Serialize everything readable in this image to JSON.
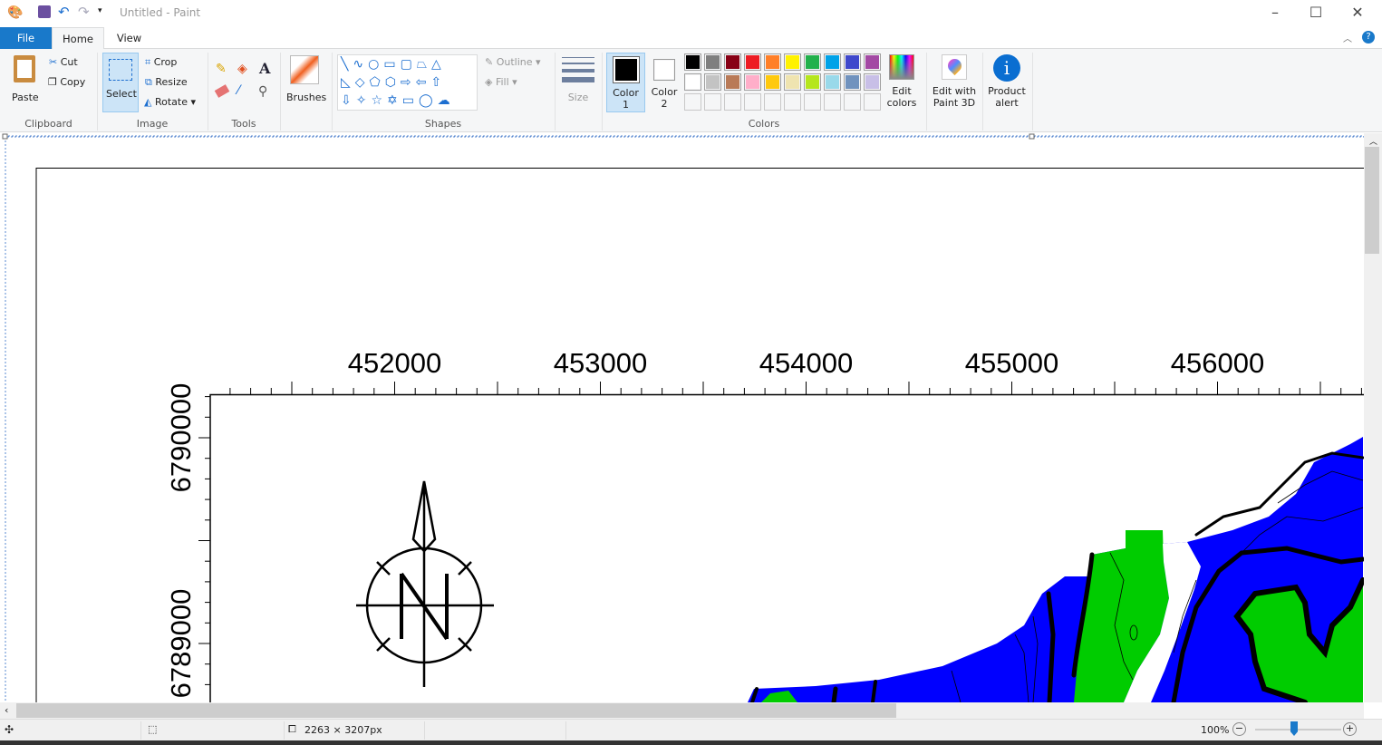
{
  "window": {
    "title": "Untitled - Paint"
  },
  "tabs": [
    {
      "label": "File"
    },
    {
      "label": "Home"
    },
    {
      "label": "View"
    }
  ],
  "clipboard": {
    "paste": "Paste",
    "cut": "Cut",
    "copy": "Copy",
    "group": "Clipboard"
  },
  "image": {
    "select": "Select",
    "crop": "Crop",
    "resize": "Resize",
    "rotate": "Rotate",
    "group": "Image"
  },
  "tools": {
    "group": "Tools"
  },
  "brushes": {
    "label": "Brushes"
  },
  "shapes": {
    "outline": "Outline",
    "fill": "Fill",
    "group": "Shapes"
  },
  "size": {
    "label": "Size"
  },
  "colors": {
    "color1": "Color 1",
    "color2": "Color 2",
    "edit": "Edit colors",
    "group": "Colors",
    "row1": [
      "#000000",
      "#7f7f7f",
      "#880015",
      "#ed1c24",
      "#ff7f27",
      "#fff200",
      "#22b14c",
      "#00a2e8",
      "#3f48cc",
      "#a349a4"
    ],
    "row2": [
      "#ffffff",
      "#c3c3c3",
      "#b97a57",
      "#ffaec9",
      "#ffc90e",
      "#efe4b0",
      "#b5e61d",
      "#99d9ea",
      "#7092be",
      "#c8bfe7"
    ],
    "selected1": "#000000",
    "selected2": "#ffffff"
  },
  "paint3d": {
    "label": "Edit with Paint 3D"
  },
  "product_alert": {
    "label": "Product alert"
  },
  "map": {
    "x_labels": [
      "452000",
      "453000",
      "454000",
      "455000",
      "456000"
    ],
    "y_labels": [
      "6790000",
      "6789000"
    ],
    "north_letter": "N",
    "colors": {
      "water": "#0000ff",
      "land": "#00cc00",
      "lines": "#000000"
    }
  },
  "status": {
    "dimensions": "2263 × 3207px",
    "zoom": "100%"
  }
}
